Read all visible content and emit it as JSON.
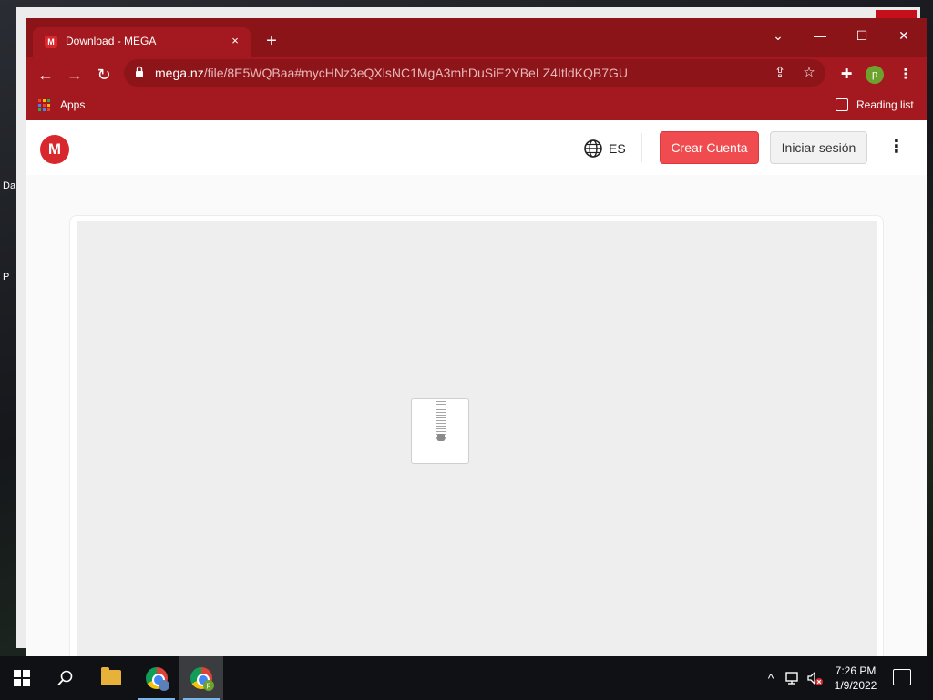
{
  "browser": {
    "tab": {
      "title": "Download - MEGA",
      "favicon": "M",
      "close": "×"
    },
    "new_tab": "+",
    "window_controls": {
      "dropdown": "⌄",
      "minimize": "—",
      "maximize": "☐",
      "close": "✕"
    },
    "toolbar": {
      "back": "←",
      "forward": "→",
      "reload": "↻",
      "url_host": "mega.nz",
      "url_path": "/file/8E5WQBaa#mycHNz3eQXlsNC1MgA3mhDuSiE2YBeLZ4ItldKQB7GU",
      "share_icon": "⇪",
      "star_icon": "☆",
      "extensions_icon": "✚",
      "profile_initial": "p",
      "menu": "⋮"
    },
    "bookmarks": {
      "apps_label": "Apps",
      "reading_list_label": "Reading list"
    }
  },
  "page": {
    "logo": "M",
    "language": "ES",
    "create_account": "Crear Cuenta",
    "login": "Iniciar sesión",
    "menu": "⋮"
  },
  "taskbar": {
    "start_icon": "windows-icon",
    "search_icon": "⌕",
    "tray_chevron": "^",
    "time": "7:26 PM",
    "date": "1/9/2022"
  },
  "colors": {
    "chrome_frame": "#8b1419",
    "chrome_toolbar": "#a4191f",
    "mega_red": "#d9272e",
    "create_button": "#f04b4f"
  }
}
